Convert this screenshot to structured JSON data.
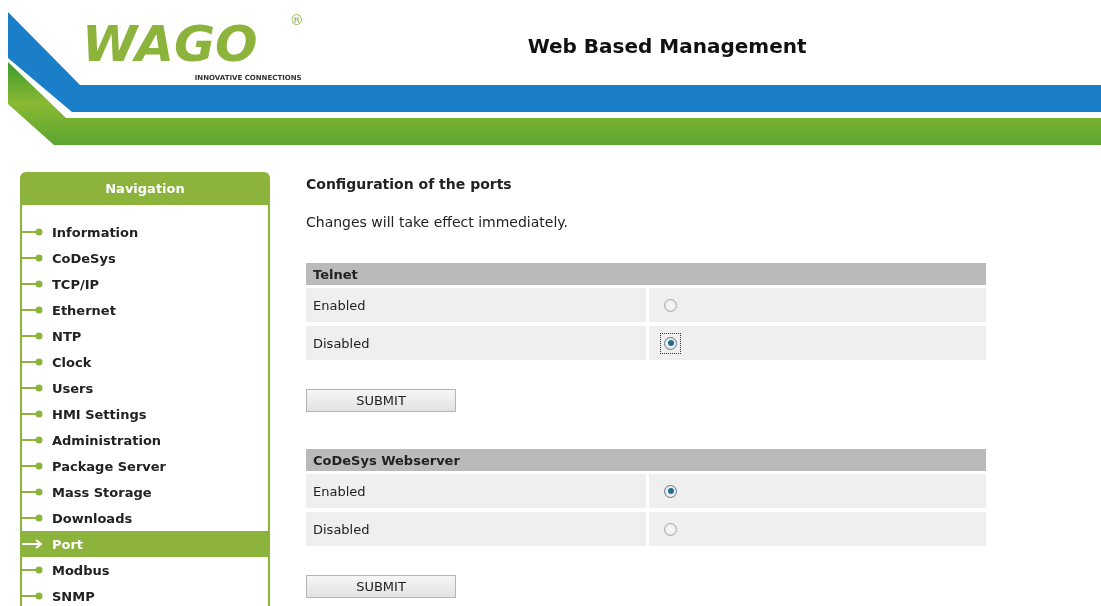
{
  "header": {
    "logo": "WAGO",
    "registered": "®",
    "tagline": "INNOVATIVE CONNECTIONS",
    "title": "Web Based Management"
  },
  "navigation": {
    "title": "Navigation",
    "items": [
      {
        "label": "Information",
        "selected": false
      },
      {
        "label": "CoDeSys",
        "selected": false
      },
      {
        "label": "TCP/IP",
        "selected": false
      },
      {
        "label": "Ethernet",
        "selected": false
      },
      {
        "label": "NTP",
        "selected": false
      },
      {
        "label": "Clock",
        "selected": false
      },
      {
        "label": "Users",
        "selected": false
      },
      {
        "label": "HMI Settings",
        "selected": false
      },
      {
        "label": "Administration",
        "selected": false
      },
      {
        "label": "Package Server",
        "selected": false
      },
      {
        "label": "Mass Storage",
        "selected": false
      },
      {
        "label": "Downloads",
        "selected": false
      },
      {
        "label": "Port",
        "selected": true
      },
      {
        "label": "Modbus",
        "selected": false
      },
      {
        "label": "SNMP",
        "selected": false
      }
    ]
  },
  "content": {
    "heading": "Configuration of the ports",
    "note": "Changes will take effect immediately.",
    "sections": [
      {
        "title": "Telnet",
        "options": [
          {
            "label": "Enabled",
            "selected": false,
            "focused": false
          },
          {
            "label": "Disabled",
            "selected": true,
            "focused": true
          }
        ],
        "button": "SUBMIT"
      },
      {
        "title": "CoDeSys Webserver",
        "options": [
          {
            "label": "Enabled",
            "selected": true,
            "focused": false
          },
          {
            "label": "Disabled",
            "selected": false,
            "focused": false
          }
        ],
        "button": "SUBMIT"
      }
    ]
  }
}
